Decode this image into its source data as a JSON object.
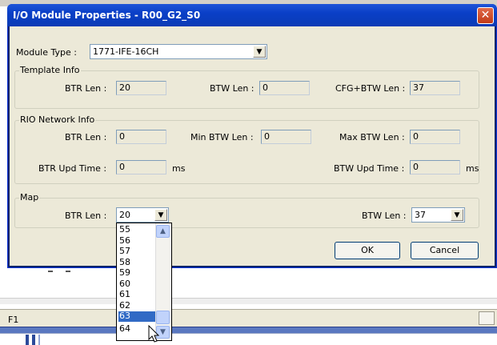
{
  "dialog": {
    "title": "I/O Module Properties - R00_G2_S0",
    "close_glyph": "✕"
  },
  "module_type": {
    "label": "Module Type :",
    "value": "1771-IFE-16CH"
  },
  "template_info": {
    "legend": "Template Info",
    "btr_len_label": "BTR Len :",
    "btr_len_value": "20",
    "btw_len_label": "BTW Len :",
    "btw_len_value": "0",
    "cfg_btw_len_label": "CFG+BTW Len :",
    "cfg_btw_len_value": "37"
  },
  "rio_network_info": {
    "legend": "RIO Network Info",
    "btr_len_label": "BTR Len :",
    "btr_len_value": "0",
    "min_btw_len_label": "Min BTW  Len :",
    "min_btw_len_value": "0",
    "max_btw_len_label": "Max BTW Len :",
    "max_btw_len_value": "0",
    "btr_upd_time_label": "BTR Upd  Time :",
    "btr_upd_time_value": "0",
    "btr_upd_time_unit": "ms",
    "btw_upd_time_label": "BTW Upd Time :",
    "btw_upd_time_value": "0",
    "btw_upd_time_unit": "ms"
  },
  "map": {
    "legend": "Map",
    "btr_len_label": "BTR Len :",
    "btr_len_value": "20",
    "btw_len_label": "BTW Len :",
    "btw_len_value": "37"
  },
  "buttons": {
    "ok": "OK",
    "cancel": "Cancel"
  },
  "dropdown": {
    "options": [
      "55",
      "56",
      "57",
      "58",
      "59",
      "60",
      "61",
      "62",
      "63",
      "64"
    ],
    "selected": "63"
  },
  "statusbar": {
    "left_text": "F1"
  },
  "icons": {
    "combo_arrow": "chevron-down-icon",
    "scroll_up": "scroll-up-icon",
    "scroll_down": "scroll-down-icon",
    "cursor": "mouse-pointer-icon"
  },
  "colors": {
    "titlebar": "#0a3fc7",
    "selection": "#316ac5",
    "close_button": "#c23a16"
  }
}
